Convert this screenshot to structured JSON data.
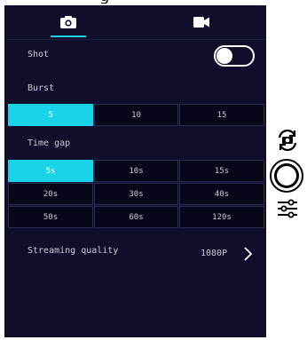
{
  "top_fragment": "g",
  "tabs": [
    {
      "name": "photo",
      "icon": "camera-icon",
      "active": true
    },
    {
      "name": "video",
      "icon": "video-camera-icon",
      "active": false
    }
  ],
  "accent_color": "#19d3e8",
  "shot": {
    "label": "Shot",
    "toggle_on": true
  },
  "burst": {
    "label": "Burst",
    "options": [
      "5",
      "10",
      "15"
    ],
    "selected": "5"
  },
  "time_gap": {
    "label": "Time gap",
    "options": [
      "5s",
      "10s",
      "15s",
      "20s",
      "30s",
      "40s",
      "50s",
      "60s",
      "120s"
    ],
    "selected": "5s"
  },
  "streaming": {
    "label": "Streaming quality",
    "value": "1080P"
  },
  "side_controls": {
    "switch_icon": "switch-camera-icon",
    "shutter_icon": "shutter-button",
    "settings_icon": "sliders-icon"
  }
}
